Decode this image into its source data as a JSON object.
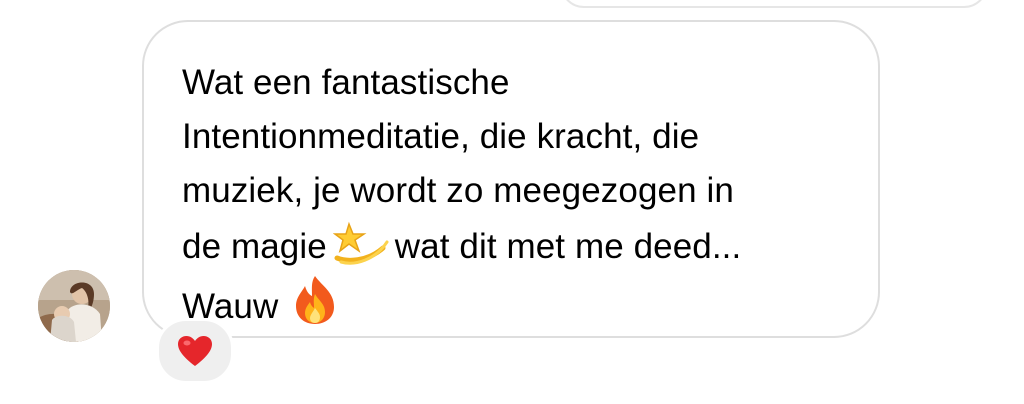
{
  "message": {
    "lines": [
      "Wat een fantastische",
      "Intentionmeditatie, die kracht, die",
      "muziek, je wordt zo meegezogen in",
      "de magie",
      "wat dit met me deed...",
      "Wauw"
    ],
    "emoji_after_magie": "dizzy-icon",
    "emoji_after_wauw": "fire-icon"
  },
  "reaction": {
    "emoji": "red-heart-icon"
  },
  "sender": {
    "avatar": "avatar"
  }
}
